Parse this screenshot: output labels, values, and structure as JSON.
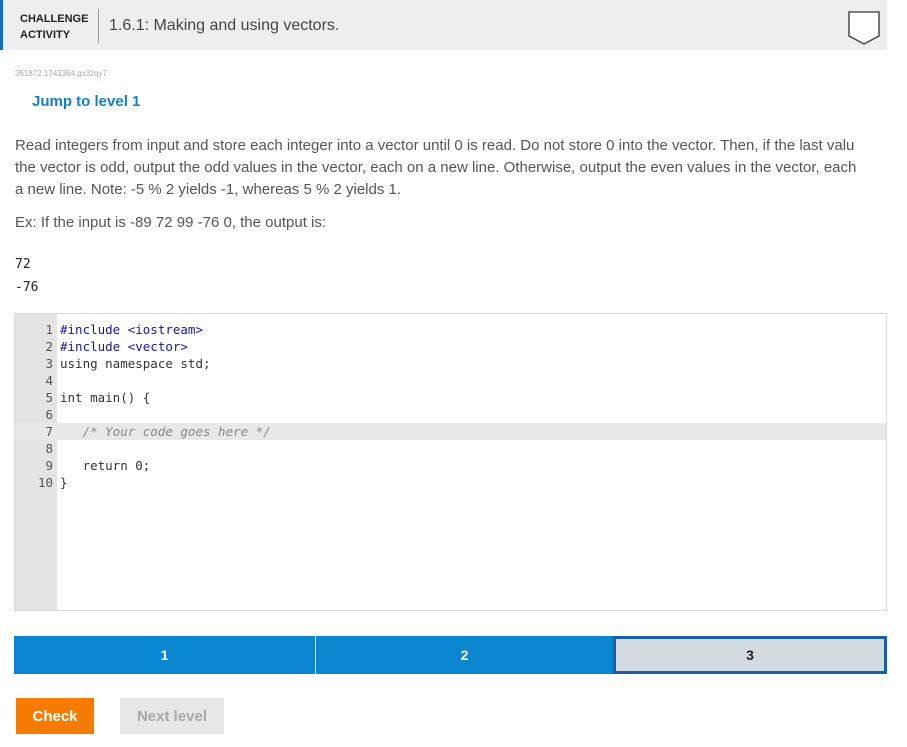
{
  "header": {
    "badge_line1": "CHALLENGE",
    "badge_line2": "ACTIVITY",
    "title": "1.6.1: Making and using vectors.",
    "accent_color": "#1a6ab5",
    "status_icon": "shield-outline-icon"
  },
  "seed": "361872.1743364.qx3zqy7",
  "jump_label": "Jump to level 1",
  "description": {
    "line1": "Read integers from input and store each integer into a vector until 0 is read. Do not store 0 into the vector. Then, if the last valu",
    "line2": "the vector is odd, output the odd values in the vector, each on a new line. Otherwise, output the even values in the vector, each",
    "line3": "a new line. Note: -5 % 2 yields -1, whereas 5 % 2 yields 1."
  },
  "example": "Ex: If the input is -89 72 99 -76 0, the output is:",
  "output": [
    "72",
    "-76"
  ],
  "code": {
    "lines": [
      {
        "n": "1",
        "text": "#include <iostream>"
      },
      {
        "n": "2",
        "text": "#include <vector>"
      },
      {
        "n": "3",
        "text": "using namespace std;"
      },
      {
        "n": "4",
        "text": ""
      },
      {
        "n": "5",
        "text": "int main() {"
      },
      {
        "n": "6",
        "text": ""
      },
      {
        "n": "7",
        "text": "   /* Your code goes here */"
      },
      {
        "n": "8",
        "text": ""
      },
      {
        "n": "9",
        "text": "   return 0;"
      },
      {
        "n": "10",
        "text": "}"
      }
    ]
  },
  "levels": [
    {
      "label": "1",
      "state": "completed"
    },
    {
      "label": "2",
      "state": "completed"
    },
    {
      "label": "3",
      "state": "current"
    }
  ],
  "buttons": {
    "check": "Check",
    "next": "Next level"
  }
}
